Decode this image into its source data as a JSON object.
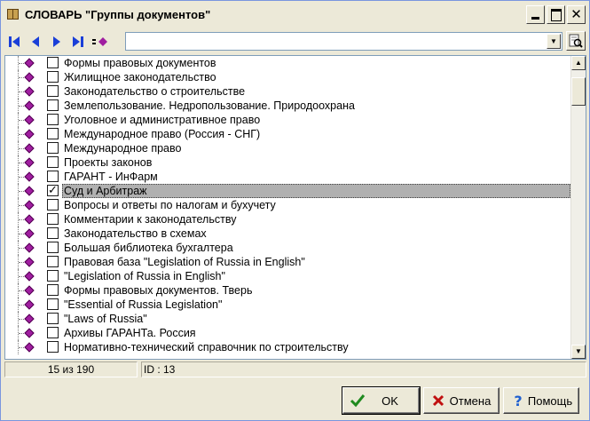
{
  "window": {
    "title": "СЛОВАРЬ \"Группы документов\""
  },
  "toolbar": {
    "search_value": ""
  },
  "list": {
    "items": [
      {
        "label": "Формы правовых документов",
        "checked": false
      },
      {
        "label": "Жилищное законодательство",
        "checked": false
      },
      {
        "label": "Законодательство о строительстве",
        "checked": false
      },
      {
        "label": "Землепользование. Недропользование. Природоохрана",
        "checked": false
      },
      {
        "label": "Уголовное и административное право",
        "checked": false
      },
      {
        "label": "Международное право (Россия - СНГ)",
        "checked": false
      },
      {
        "label": "Международное право",
        "checked": false
      },
      {
        "label": "Проекты законов",
        "checked": false
      },
      {
        "label": "ГАРАНТ - ИнФарм",
        "checked": false
      },
      {
        "label": "Суд и Арбитраж",
        "checked": true,
        "selected": true
      },
      {
        "label": "Вопросы и ответы по налогам и бухучету",
        "checked": false
      },
      {
        "label": "Комментарии к законодательству",
        "checked": false
      },
      {
        "label": "Законодательство в схемах",
        "checked": false
      },
      {
        "label": "Большая библиотека бухгалтера",
        "checked": false
      },
      {
        "label": "Правовая база \"Legislation of Russia in English\"",
        "checked": false
      },
      {
        "label": "\"Legislation of Russia in English\"",
        "checked": false
      },
      {
        "label": "Формы правовых документов. Тверь",
        "checked": false
      },
      {
        "label": "\"Essential of Russia Legislation\"",
        "checked": false
      },
      {
        "label": "\"Laws of Russia\"",
        "checked": false
      },
      {
        "label": "Архивы ГАРАНТа. Россия",
        "checked": false
      },
      {
        "label": "Нормативно-технический справочник по строительству",
        "checked": false
      }
    ]
  },
  "status": {
    "count": "15 из 190",
    "id": "ID : 13"
  },
  "buttons": {
    "ok": "OK",
    "cancel": "Отмена",
    "help": "Помощь"
  },
  "colors": {
    "accent": "#1A3FD8",
    "diamond": "#A01EA0",
    "selection": "#B0B0B0"
  }
}
